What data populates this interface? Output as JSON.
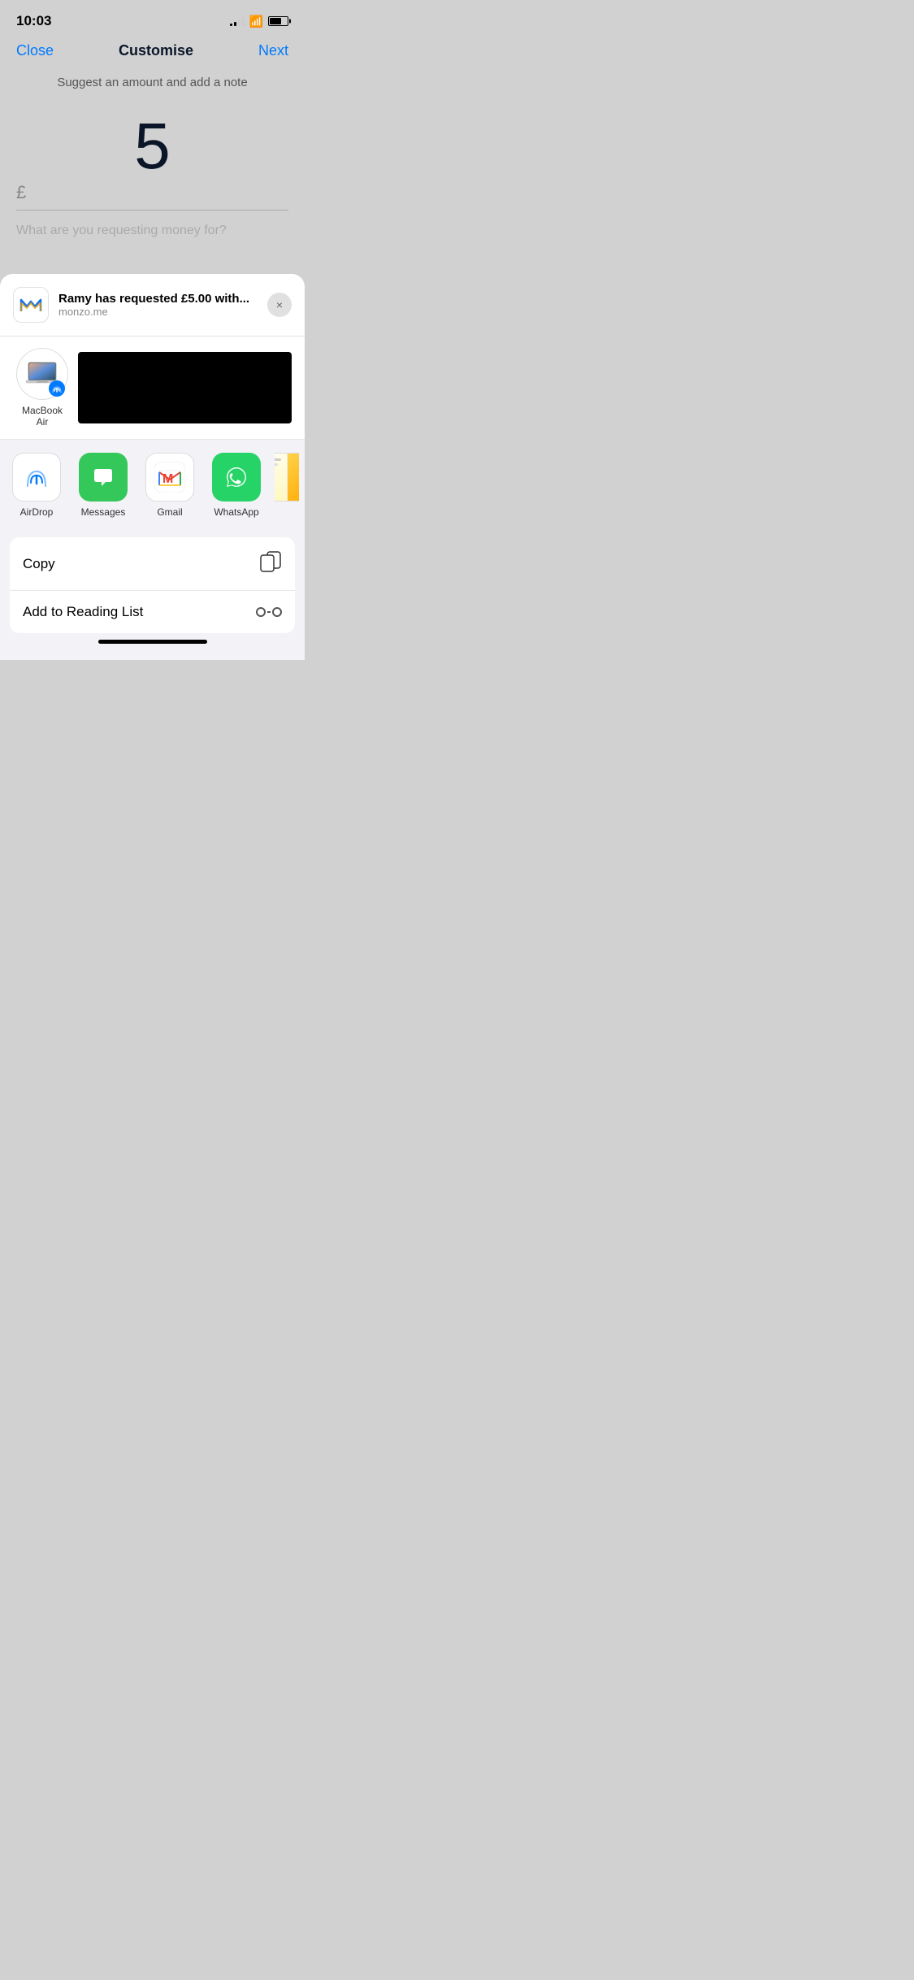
{
  "statusBar": {
    "time": "10:03"
  },
  "navBar": {
    "close": "Close",
    "title": "Customise",
    "next": "Next"
  },
  "mainScreen": {
    "subtitle": "Suggest an amount and add a note",
    "amount": "5",
    "currency": "£",
    "notePlaceholder": "What are you requesting money for?"
  },
  "shareSheet": {
    "preview": {
      "title": "Ramy has requested £5.00 with...",
      "url": "monzo.me",
      "closeLabel": "×"
    },
    "airdropDevice": {
      "name": "MacBook\nAir"
    },
    "apps": [
      {
        "name": "AirDrop",
        "icon": "airdrop"
      },
      {
        "name": "Messages",
        "icon": "messages"
      },
      {
        "name": "Gmail",
        "icon": "gmail"
      },
      {
        "name": "WhatsApp",
        "icon": "whatsapp"
      }
    ],
    "actions": [
      {
        "label": "Copy",
        "icon": "copy"
      },
      {
        "label": "Add to Reading List",
        "icon": "reading-glasses"
      }
    ]
  }
}
